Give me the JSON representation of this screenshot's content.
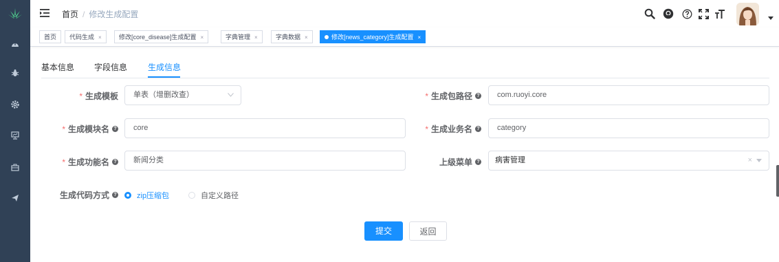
{
  "breadcrumb": {
    "home": "首页",
    "separator": "/",
    "current": "修改生成配置"
  },
  "tags": [
    {
      "label": "首页",
      "closable": false
    },
    {
      "label": "代码生成",
      "closable": true
    },
    {
      "label": "修改[core_disease]生成配置",
      "closable": true
    },
    {
      "label": "字典管理",
      "closable": true
    },
    {
      "label": "字典数据",
      "closable": true
    },
    {
      "label": "修改[news_category]生成配置",
      "closable": true,
      "active": true
    }
  ],
  "tag_close": "×",
  "form_tabs": [
    "基本信息",
    "字段信息",
    "生成信息"
  ],
  "active_tab": "生成信息",
  "form": {
    "tpl_category": {
      "label": "生成模板",
      "value": "单表（增删改查）"
    },
    "package_name": {
      "label": "生成包路径",
      "value": "com.ruoyi.core"
    },
    "module_name": {
      "label": "生成模块名",
      "value": "core"
    },
    "business_name": {
      "label": "生成业务名",
      "value": "category"
    },
    "function_name": {
      "label": "生成功能名",
      "value": "新闻分类"
    },
    "parent_menu": {
      "label": "上级菜单",
      "value": "病害管理"
    },
    "gen_type": {
      "label": "生成代码方式",
      "options": [
        "zip压缩包",
        "自定义路径"
      ],
      "selected": "zip压缩包"
    }
  },
  "required_mark": "*",
  "help_mark": "?",
  "buttons": {
    "submit": "提交",
    "back": "返回"
  },
  "colors": {
    "sidebar": "#304156",
    "primary": "#1890ff",
    "required": "#f56c6c"
  },
  "icons": {
    "sidebar": [
      "logo-icon",
      "dashboard-icon",
      "bug-icon",
      "gear-icon",
      "monitor-icon",
      "toolbox-icon",
      "send-icon"
    ],
    "navbar": [
      "hamburger-icon",
      "search-icon",
      "github-icon",
      "question-icon",
      "fullscreen-icon",
      "font-size-icon"
    ]
  }
}
